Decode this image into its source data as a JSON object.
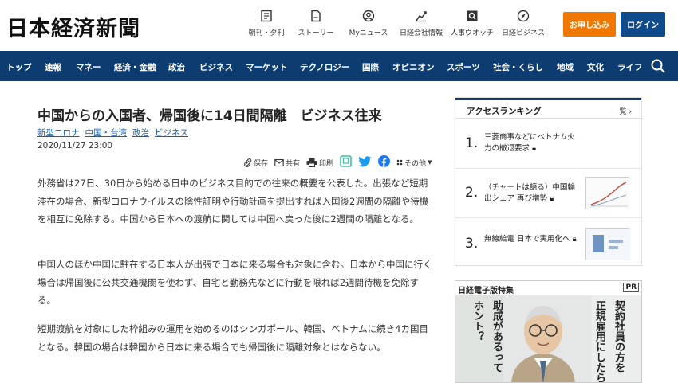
{
  "header": {
    "logo": "日本経済新聞",
    "icons": [
      {
        "icon": "newspaper-icon",
        "label": "朝刊・夕刊"
      },
      {
        "icon": "document-icon",
        "label": "ストーリー"
      },
      {
        "icon": "user-icon",
        "label": "Myニュース"
      },
      {
        "icon": "chart-icon",
        "label": "日経会社情報"
      },
      {
        "icon": "search-doc-icon",
        "label": "人事ウオッチ"
      },
      {
        "icon": "compass-icon",
        "label": "日経ビジネス"
      }
    ],
    "signup_label": "お申し込み",
    "login_label": "ログイン"
  },
  "nav": {
    "items": [
      "トップ",
      "速報",
      "マネー",
      "経済・金融",
      "政治",
      "ビジネス",
      "マーケット",
      "テクノロジー",
      "国際",
      "オピニオン",
      "スポーツ",
      "社会・くらし",
      "地域",
      "文化",
      "ライフ"
    ]
  },
  "article": {
    "headline": "中国からの入国者、帰国後に14日間隔離　ビジネス往来",
    "tags": [
      "新型コロナ",
      "中国・台湾",
      "政治",
      "ビジネス"
    ],
    "date": "2020/11/27 23:00",
    "share": {
      "save": "保存",
      "share": "共有",
      "print": "印刷",
      "other": "その他"
    },
    "paragraphs": [
      "外務省は27日、30日から始める日中のビジネス目的での往来の概要を公表した。出張など短期滞在の場合、新型コロナウイルスの陰性証明や行動計画を提出すれば入国後2週間の隔離や待機を相互に免除する。中国から日本への渡航に関しては中国へ戻った後に2週間の隔離となる。",
      "中国人のほか中国に駐在する日本人が出張で日本に来る場合も対象に含む。日本から中国に行く場合は帰国後に公共交通機関を使わず、自宅と勤務先などに行動を限れば2週間待機を免除する。",
      "短期渡航を対象にした枠組みの運用を始めるのはシンガポール、韓国、ベトナムに続き4カ国目となる。韓国の場合は韓国から日本に来る場合でも帰国後に隔離対象とはならない。"
    ]
  },
  "sidebar": {
    "ranking_title": "アクセスランキング",
    "ranking_more": "一覧 ›",
    "ranking": [
      {
        "num": "1.",
        "text": "三菱商事などにベトナム火力の撤退要求"
      },
      {
        "num": "2.",
        "text": "（チャートは語る）中国輸出シェア 再び増勢"
      },
      {
        "num": "3.",
        "text": "無線給電 日本で実用化へ"
      }
    ],
    "ad_title": "日経電子版特集",
    "ad_pr": "PR",
    "ad_copy": [
      "ホント？",
      "助成があるって",
      "正規雇用にしたら",
      "契約社員の方を"
    ]
  },
  "colors": {
    "nav_bg": "#0d3d70",
    "signup": "#f07800",
    "login": "#0f4a8a",
    "link": "#1a5ea8"
  }
}
